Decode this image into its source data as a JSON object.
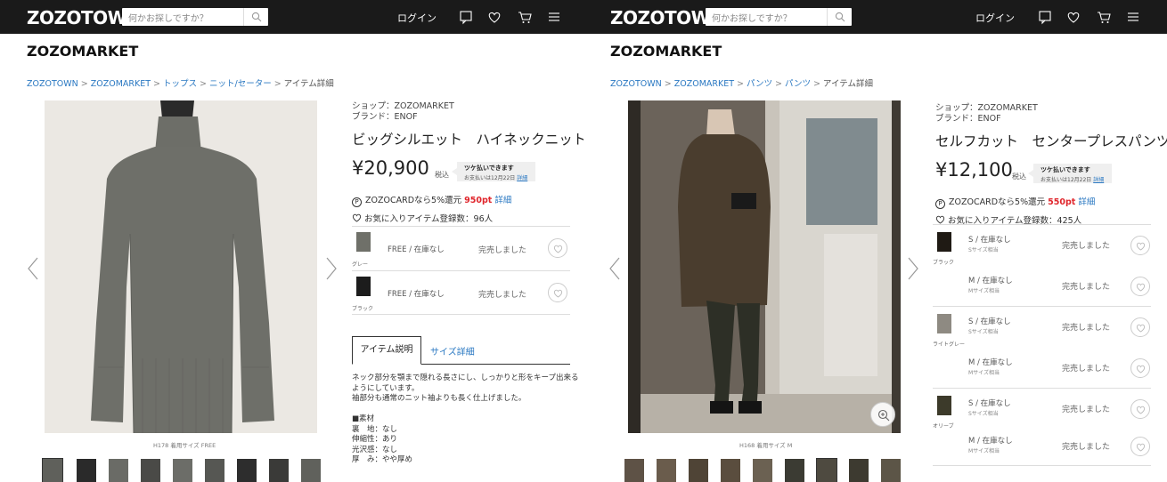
{
  "header": {
    "logo": "ZOZOTOWN",
    "search_placeholder": "何かお探しですか？",
    "login": "ログイン",
    "icons": [
      "comment-icon",
      "heart-icon",
      "cart-icon",
      "menu-icon"
    ]
  },
  "left": {
    "market": "ZOZOMARKET",
    "breadcrumb": [
      "ZOZOTOWN",
      "ZOZOMARKET",
      "トップス",
      "ニット/セーター",
      "アイテム詳細"
    ],
    "image_caption": "H178 着用サイズ FREE",
    "shop": "ショップ：ZOZOMARKET",
    "brand": "ブランド：ENOF",
    "title": "ビッグシルエット　ハイネックニット",
    "price": "¥20,900",
    "tax": "税込",
    "tsuke_title": "ツケ払いできます",
    "tsuke_sub": "お支払いは12月22日",
    "tsuke_link": "詳細",
    "point_prefix": "ZOZOCARDなら5%還元",
    "points": "950pt",
    "point_more": "詳細",
    "favorites": "お気に入りアイテム登録数：96人",
    "stock": [
      {
        "color": "グレー",
        "size": "FREE / 在庫なし",
        "status": "完売しました",
        "swatch": "#6f7069"
      },
      {
        "color": "ブラック",
        "size": "FREE / 在庫なし",
        "status": "完売しました",
        "swatch": "#1c1c1c"
      }
    ],
    "tabs": [
      "アイテム説明",
      "サイズ詳細"
    ],
    "description": [
      "ネック部分を顎まで隠れる長さにし、しっかりと形をキープ出来る",
      "ようにしています。",
      "袖部分も通常のニット袖よりも長く仕上げました。",
      "",
      "■素材",
      "裏　地：なし",
      "伸縮性：あり",
      "光沢感：なし",
      "厚　み：やや厚め"
    ]
  },
  "right": {
    "market": "ZOZOMARKET",
    "breadcrumb": [
      "ZOZOTOWN",
      "ZOZOMARKET",
      "パンツ",
      "パンツ",
      "アイテム詳細"
    ],
    "image_caption": "H168 着用サイズ M",
    "shop": "ショップ：ZOZOMARKET",
    "brand": "ブランド：ENOF",
    "title": "セルフカット　センタープレスパンツ",
    "price": "¥12,100",
    "tax": "税込",
    "tsuke_title": "ツケ払いできます",
    "tsuke_sub": "お支払いは12月22日",
    "tsuke_link": "詳細",
    "point_prefix": "ZOZOCARDなら5%還元",
    "points": "550pt",
    "point_more": "詳細",
    "favorites": "お気に入りアイテム登録数：425人",
    "stock_groups": [
      {
        "color": "ブラック",
        "swatch": "#1f1a14",
        "rows": [
          {
            "size": "S / 在庫なし",
            "sub": "Sサイズ相当",
            "status": "完売しました"
          },
          {
            "size": "M / 在庫なし",
            "sub": "Mサイズ相当",
            "status": "完売しました"
          }
        ]
      },
      {
        "color": "ライトグレー",
        "swatch": "#8e8a82",
        "rows": [
          {
            "size": "S / 在庫なし",
            "sub": "Sサイズ相当",
            "status": "完売しました"
          },
          {
            "size": "M / 在庫なし",
            "sub": "Mサイズ相当",
            "status": "完売しました"
          }
        ]
      },
      {
        "color": "オリーブ",
        "swatch": "#3c3a2a",
        "rows": [
          {
            "size": "S / 在庫なし",
            "sub": "Sサイズ相当",
            "status": "完売しました"
          },
          {
            "size": "M / 在庫なし",
            "sub": "Mサイズ相当",
            "status": "完売しました"
          }
        ]
      }
    ]
  }
}
